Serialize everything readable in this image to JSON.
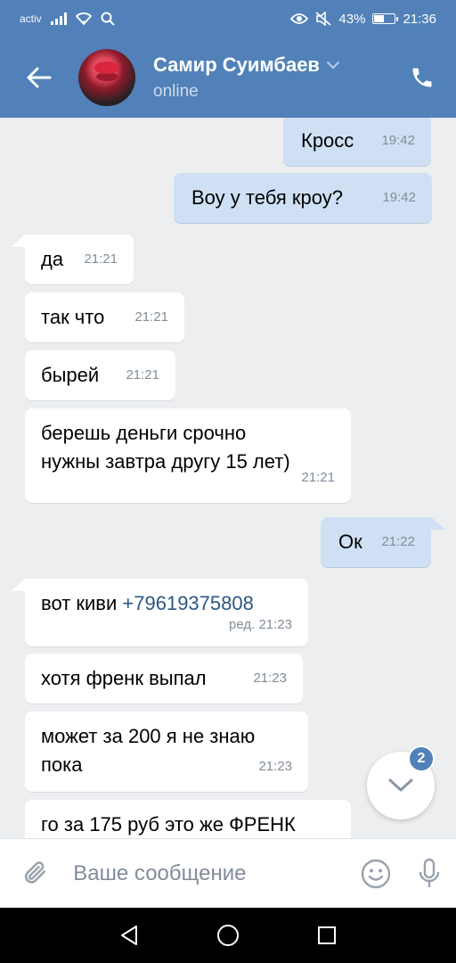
{
  "statusbar": {
    "carrier": "activ",
    "battery_percent": "43%",
    "battery_level": 0.43,
    "time": "21:36",
    "icons": [
      "signal-icon",
      "wifi-icon",
      "search-icon",
      "eye-icon",
      "mute-icon",
      "battery-icon"
    ]
  },
  "header": {
    "contact_name": "Самир Суимбаев",
    "status": "online",
    "icons": [
      "back-arrow-icon",
      "chevron-down-icon",
      "phone-icon"
    ]
  },
  "messages": [
    {
      "direction": "out",
      "text": "Кросс",
      "time": "19:42"
    },
    {
      "direction": "out",
      "text": "Воу у тебя кроу?",
      "time": "19:42"
    },
    {
      "direction": "in",
      "text": "да",
      "time": "21:21"
    },
    {
      "direction": "in",
      "text": "так что",
      "time": "21:21"
    },
    {
      "direction": "in",
      "text": "бырей",
      "time": "21:21"
    },
    {
      "direction": "in",
      "text_line1": "берешь деньги срочно",
      "text_line2": "нужны завтра другу 15 лет)",
      "time": "21:21"
    },
    {
      "direction": "out",
      "text": "Ок",
      "time": "21:22"
    },
    {
      "direction": "in",
      "text": "вот киви",
      "phone": "+79619375808",
      "time": "ред. 21:23"
    },
    {
      "direction": "in",
      "text": "хотя френк выпал",
      "time": "21:23"
    },
    {
      "direction": "in",
      "text_line1": "может за 200 я не знаю",
      "text_line2": "пока",
      "time": "21:23"
    },
    {
      "direction": "in",
      "text": "го за 175 руб это же ФРЕНК"
    }
  ],
  "scroll_down": {
    "unread_count": "2"
  },
  "composer": {
    "placeholder": "Ваше сообщение",
    "icons": [
      "paperclip-icon",
      "emoji-icon",
      "microphone-icon"
    ]
  },
  "navbar": {
    "icons": [
      "nav-back-icon",
      "nav-home-icon",
      "nav-recents-icon"
    ]
  },
  "colors": {
    "accent": "#5181b8",
    "outgoing_bubble": "#cfe0f4",
    "incoming_bubble": "#ffffff",
    "chat_background": "#edeef0",
    "link": "#2a5885"
  }
}
